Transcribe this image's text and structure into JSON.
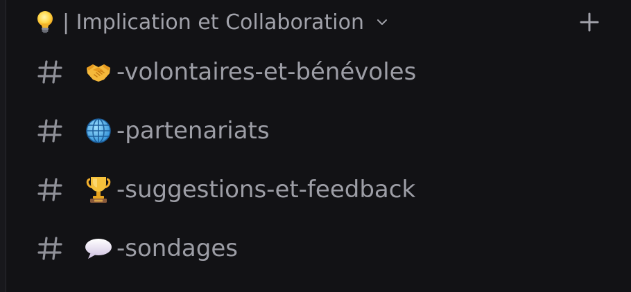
{
  "category": {
    "emoji": "bulb",
    "label": "| Implication et Collaboration"
  },
  "channels": [
    {
      "emoji": "handshake",
      "name": "-volontaires-et-bénévoles"
    },
    {
      "emoji": "globe",
      "name": "-partenariats"
    },
    {
      "emoji": "trophy",
      "name": "-suggestions-et-feedback"
    },
    {
      "emoji": "speech-balloon",
      "name": "-sondages"
    }
  ],
  "colors": {
    "background": "#121215",
    "text": "#9d9ea6",
    "icon": "#8f9098"
  }
}
